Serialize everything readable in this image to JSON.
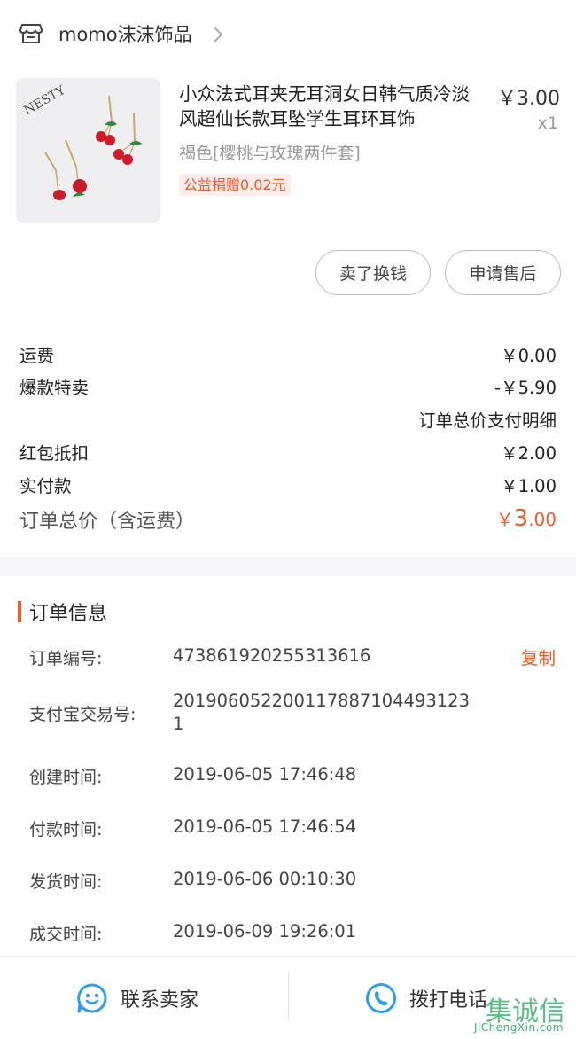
{
  "shop": {
    "name": "momo沫沫饰品"
  },
  "product": {
    "title": "小众法式耳夹无耳洞女日韩气质冷淡风超仙长款耳坠学生耳环耳饰",
    "price": "￥3.00",
    "quantity": "x1",
    "sku": "褐色[樱桃与玫瑰两件套]",
    "charity": "公益捐赠0.02元",
    "image_text": "NESTY"
  },
  "actions": {
    "sell_label": "卖了换钱",
    "after_sale_label": "申请售后"
  },
  "price_details": {
    "shipping": {
      "label": "运费",
      "value": "￥0.00"
    },
    "special": {
      "label": "爆款特卖",
      "value": "-￥5.90"
    },
    "detail_link": "订单总价支付明细",
    "red_packet": {
      "label": "红包抵扣",
      "value": "￥2.00"
    },
    "paid": {
      "label": "实付款",
      "value": "￥1.00"
    },
    "total": {
      "label": "订单总价（含运费）",
      "currency": "￥",
      "integer": "3",
      "decimal": ".00"
    }
  },
  "order_info": {
    "title": "订单信息",
    "copy_label": "复制",
    "rows": [
      {
        "label": "订单编号:",
        "value": "473861920255313616"
      },
      {
        "label": "支付宝交易号:",
        "value": "2019060522001178871044931231"
      },
      {
        "label": "创建时间:",
        "value": "2019-06-05 17:46:48"
      },
      {
        "label": "付款时间:",
        "value": "2019-06-05 17:46:54"
      },
      {
        "label": "发货时间:",
        "value": "2019-06-06 00:10:30"
      },
      {
        "label": "成交时间:",
        "value": "2019-06-09 19:26:01"
      }
    ]
  },
  "bottom": {
    "contact_label": "联系卖家",
    "call_label": "拨打电话"
  },
  "watermark": {
    "text": "JiChengXin.com",
    "glyphs": "集诚信"
  },
  "colors": {
    "accent": "#f05a28",
    "icon_blue": "#2f9cf0"
  },
  "icons": {
    "shop": "store-icon",
    "chevron": "chevron-right-icon",
    "contact": "chat-face-icon",
    "call": "phone-icon"
  }
}
